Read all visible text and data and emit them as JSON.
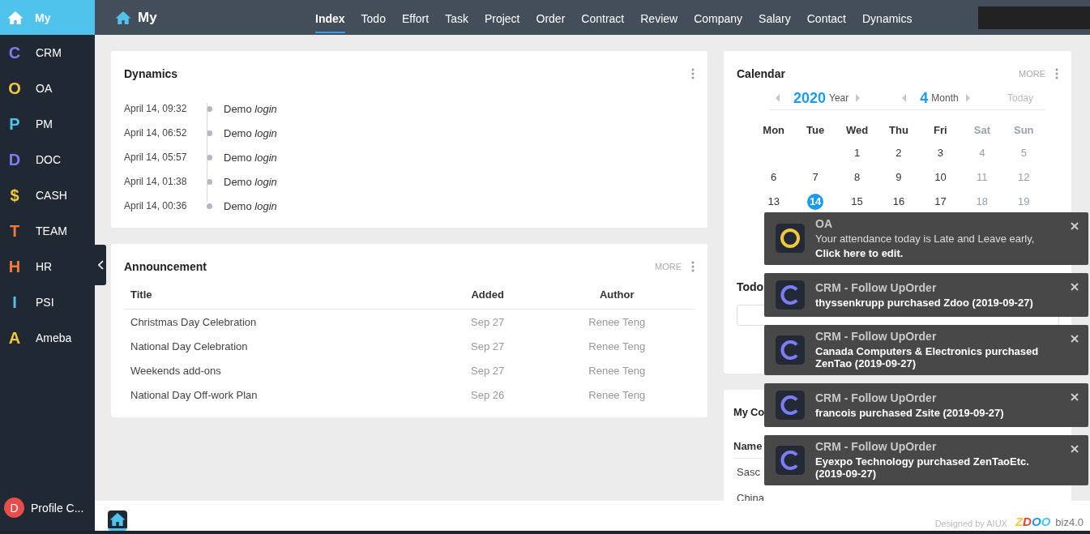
{
  "sidebar": {
    "home": {
      "label": "My",
      "selected": true
    },
    "items": [
      {
        "letter": "C",
        "label": "CRM",
        "color": "#7b7df5"
      },
      {
        "letter": "O",
        "label": "OA",
        "color": "#f2c83c"
      },
      {
        "letter": "P",
        "label": "PM",
        "color": "#4fc2ec"
      },
      {
        "letter": "D",
        "label": "DOC",
        "color": "#7b7df5"
      },
      {
        "letter": "$",
        "label": "CASH",
        "color": "#f2c83c"
      },
      {
        "letter": "T",
        "label": "TEAM",
        "color": "#f37b3a"
      },
      {
        "letter": "H",
        "label": "HR",
        "color": "#f37b3a"
      },
      {
        "letter": "I",
        "label": "PSI",
        "color": "#4fc2ec"
      },
      {
        "letter": "A",
        "label": "Ameba",
        "color": "#f2c83c"
      }
    ],
    "profile": {
      "initial": "D",
      "label": "Profile C..."
    }
  },
  "topbar": {
    "title": "My",
    "tabs": [
      {
        "label": "Index",
        "selected": true
      },
      {
        "label": "Todo",
        "selected": false
      },
      {
        "label": "Effort",
        "selected": false
      },
      {
        "label": "Task",
        "selected": false
      },
      {
        "label": "Project",
        "selected": false
      },
      {
        "label": "Order",
        "selected": false
      },
      {
        "label": "Contract",
        "selected": false
      },
      {
        "label": "Review",
        "selected": false
      },
      {
        "label": "Company",
        "selected": false
      },
      {
        "label": "Salary",
        "selected": false
      },
      {
        "label": "Contact",
        "selected": false
      },
      {
        "label": "Dynamics",
        "selected": false
      }
    ]
  },
  "dynamics": {
    "title": "Dynamics",
    "entries": [
      {
        "time": "April 14, 09:32",
        "text": "Demo *login*"
      },
      {
        "time": "April 14, 06:52",
        "text": "Demo *login*"
      },
      {
        "time": "April 14, 05:57",
        "text": "Demo *login*"
      },
      {
        "time": "April 14, 01:38",
        "text": "Demo *login*"
      },
      {
        "time": "April 14, 00:36",
        "text": "Demo *login*"
      }
    ]
  },
  "announcement": {
    "title": "Announcement",
    "more": "MORE",
    "columns": [
      "Title",
      "Added",
      "Author"
    ],
    "rows": [
      [
        "Christmas Day Celebration",
        "Sep 27",
        "Renee Teng"
      ],
      [
        "National Day Celebration",
        "Sep 27",
        "Renee Teng"
      ],
      [
        "Weekends add-ons",
        "Sep 27",
        "Renee Teng"
      ],
      [
        "National Day Off-work Plan",
        "Sep 26",
        "Renee Teng"
      ]
    ]
  },
  "calendar": {
    "title": "Calendar",
    "more": "MORE",
    "year": "2020",
    "year_label": "Year",
    "month": "4",
    "month_label": "Month",
    "today": "Today",
    "weekdays": [
      "Mon",
      "Tue",
      "Wed",
      "Thu",
      "Fri",
      "Sat",
      "Sun"
    ],
    "weeks": [
      [
        {
          "day": "1",
          "selected": false
        },
        {
          "day": "2",
          "selected": false
        },
        {
          "day": "3",
          "selected": false
        },
        {
          "day": "4",
          "selected": false
        },
        {
          "day": "5",
          "selected": false
        }
      ],
      [
        {
          "day": "6",
          "selected": false
        },
        {
          "day": "7",
          "selected": false
        },
        {
          "day": "8",
          "selected": false
        },
        {
          "day": "9",
          "selected": false
        },
        {
          "day": "10",
          "selected": false
        },
        {
          "day": "11",
          "selected": false
        },
        {
          "day": "12",
          "selected": false
        }
      ],
      [
        {
          "day": "13",
          "selected": false
        },
        {
          "day": "14",
          "selected": true
        },
        {
          "day": "15",
          "selected": false
        },
        {
          "day": "16",
          "selected": false
        },
        {
          "day": "17",
          "selected": false
        },
        {
          "day": "18",
          "selected": false
        },
        {
          "day": "19",
          "selected": false
        }
      ]
    ]
  },
  "todo": {
    "title": "Todo"
  },
  "contract": {
    "title": "My Co",
    "column": "Name",
    "rows": [
      "Sasc",
      "China"
    ]
  },
  "toasts": [
    {
      "kind": "oa",
      "title": "OA",
      "message": "Your attendance today is Late and Leave early,",
      "action": "Click here to edit."
    },
    {
      "kind": "crm",
      "title": "CRM - Follow UpOrder",
      "message": "thyssenkrupp purchased Zdoo (2019-09-27)"
    },
    {
      "kind": "crm",
      "title": "CRM - Follow UpOrder",
      "message": "Canada Computers & Electronics purchased ZenTao (2019-09-27)"
    },
    {
      "kind": "crm",
      "title": "CRM - Follow UpOrder",
      "message": "francois purchased Zsite (2019-09-27)"
    },
    {
      "kind": "crm",
      "title": "CRM - Follow UpOrder",
      "message": "Eyexpo Technology purchased ZenTaoEtc. (2019-09-27)"
    }
  ],
  "footer": {
    "credit": "Designed by AIUX",
    "logo": [
      "Z",
      "D",
      "O",
      "O"
    ],
    "version": "biz4.0"
  }
}
